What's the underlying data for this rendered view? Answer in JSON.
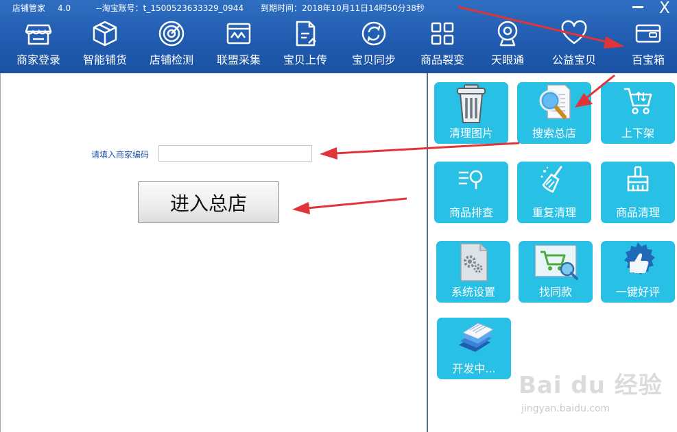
{
  "titlebar": {
    "app_name": "店铺管家",
    "version": "4.0",
    "account": "--淘宝账号：t_1500523633329_0944",
    "expiry": "到期时间：2018年10月11日14时50分38秒",
    "minimize_icon": "minimize-icon",
    "close_label": "X"
  },
  "nav": {
    "items": [
      {
        "label": "商家登录",
        "icon": "storefront-icon"
      },
      {
        "label": "智能铺货",
        "icon": "box-icon"
      },
      {
        "label": "店铺检测",
        "icon": "radar-icon"
      },
      {
        "label": "联盟采集",
        "icon": "wave-chart-icon"
      },
      {
        "label": "宝贝上传",
        "icon": "upload-document-icon"
      },
      {
        "label": "宝贝同步",
        "icon": "sync-icon"
      },
      {
        "label": "商品裂变",
        "icon": "grid-icon"
      },
      {
        "label": "天眼通",
        "icon": "webcam-icon"
      },
      {
        "label": "公益宝贝",
        "icon": "heart-icon"
      },
      {
        "label": "百宝箱",
        "icon": "wallet-icon"
      }
    ]
  },
  "form": {
    "merchant_label": "请填入商家编码",
    "merchant_value": "",
    "merchant_placeholder": "",
    "enter_button": "进入总店"
  },
  "tools": {
    "items": [
      {
        "label": "清理图片",
        "icon": "trash-icon"
      },
      {
        "label": "搜索总店",
        "icon": "magnifier-document-icon"
      },
      {
        "label": "上下架",
        "icon": "shopping-cart-icon"
      },
      {
        "label": "商品排查",
        "icon": "list-search-icon"
      },
      {
        "label": "重复清理",
        "icon": "broom-icon"
      },
      {
        "label": "商品清理",
        "icon": "brush-icon"
      },
      {
        "label": "系统设置",
        "icon": "gear-document-icon"
      },
      {
        "label": "找同款",
        "icon": "cart-search-icon"
      },
      {
        "label": "一键好评",
        "icon": "thumbs-up-badge-icon"
      },
      {
        "label": "开发中...",
        "icon": "stacked-documents-icon"
      }
    ]
  },
  "colors": {
    "topbar": "#1f5aaf",
    "tile": "#29c0e6",
    "arrow": "#e0343a",
    "label_blue": "#2458a8"
  },
  "watermark": {
    "brand": "Bai du 经验",
    "url": "jingyan.baidu.com"
  }
}
